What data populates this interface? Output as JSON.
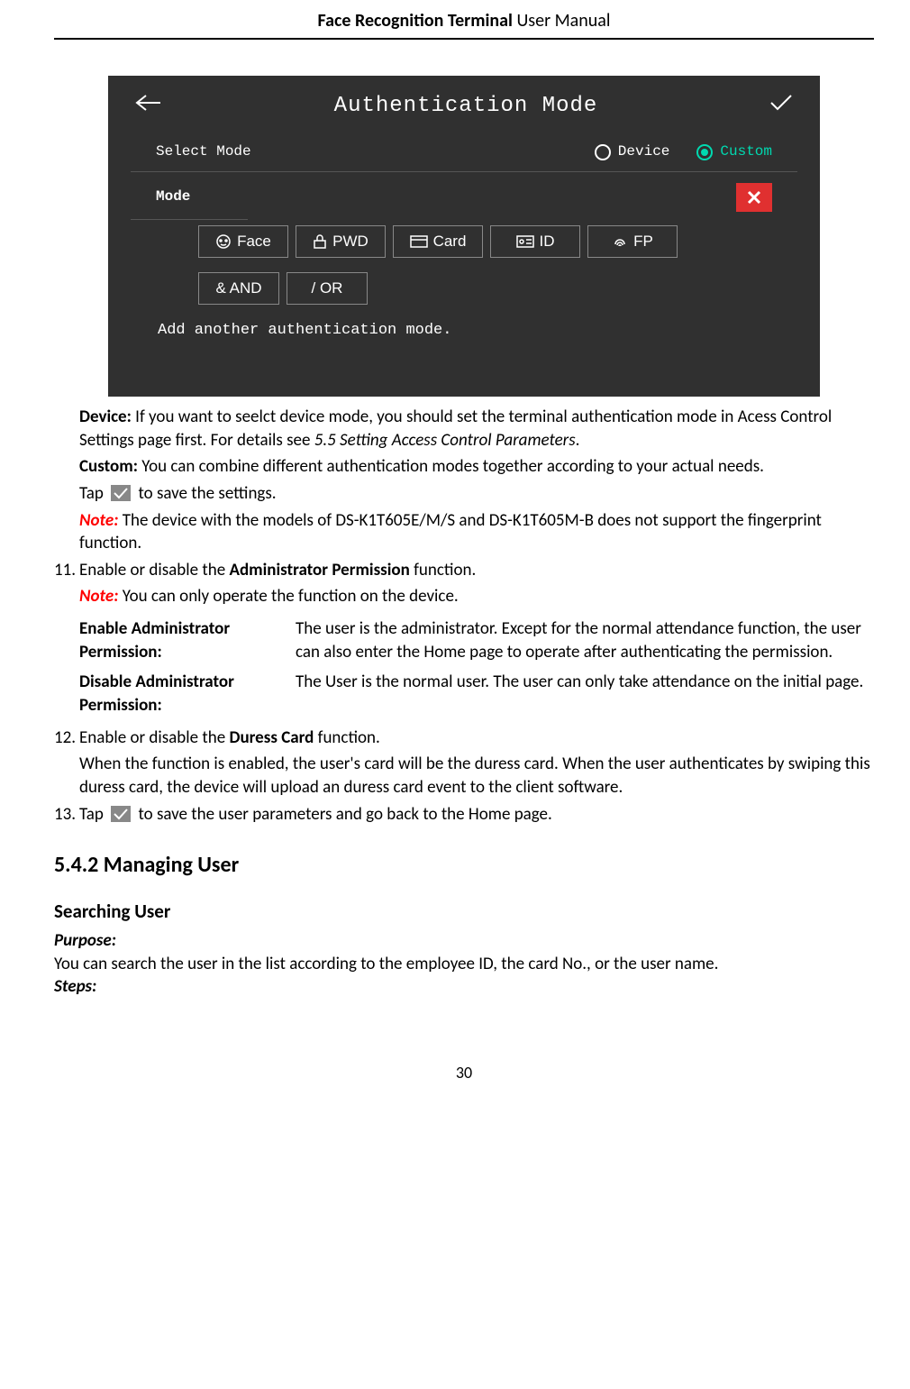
{
  "header": {
    "bold": "Face Recognition Terminal",
    "thin": " User Manual"
  },
  "screenshot": {
    "title": "Authentication Mode",
    "select_mode_label": "Select Mode",
    "radio_device": "Device",
    "radio_custom": "Custom",
    "mode_label": "Mode",
    "btn_face": "Face",
    "btn_pwd": "PWD",
    "btn_card": "Card",
    "btn_id": "ID",
    "btn_fp": "FP",
    "btn_and": "&  AND",
    "btn_or": "/  OR",
    "hint": "Add another authentication mode."
  },
  "p_device_label": "Device:",
  "p_device_text": " If you want to seelct device mode, you should set the terminal authentication mode in Acess Control Settings page first. For details see ",
  "p_device_ref": "5.5 Setting Access Control Parameters",
  "p_device_end": ".",
  "p_custom_label": "Custom:",
  "p_custom_text": " You can combine different authentication modes together according to your actual needs.",
  "p_tap_before": "Tap ",
  "p_tap_after": " to save the settings.",
  "note_label": "Note:",
  "note1_text": " The device with the models of DS-K1T605E/M/S and DS-K1T605M-B does not support the fingerprint function.",
  "li11_num": "11.",
  "li11_a": "Enable or disable the ",
  "li11_b": "Administrator Permission",
  "li11_c": " function.",
  "note2_text": " You can only operate the function on the device.",
  "def1_label": "Enable Administrator Permission:",
  "def1_text": "The user is the administrator. Except for the normal attendance function, the user can also enter the Home page to operate after authenticating the permission.",
  "def2_label": "Disable Administrator Permission:",
  "def2_text": "The User is the normal user. The user can only take attendance on the initial page.",
  "li12_num": "12.",
  "li12_a": "Enable or disable the ",
  "li12_b": "Duress Card",
  "li12_c": " function.",
  "li12_p2": "When the function is enabled, the user's card will be the duress card. When the user authenticates by swiping this duress card, the device will upload an duress card event to the client software.",
  "li13_num": "13.",
  "li13_a": "Tap ",
  "li13_b": " to save the user parameters and go back to the Home page.",
  "h2": "5.4.2   Managing User",
  "h3": "Searching User",
  "purpose_label": "Purpose:",
  "purpose_text": "You can search the user in the list according to the employee ID, the card No., or the user name.",
  "steps_label": "Steps:",
  "page_num": "30"
}
